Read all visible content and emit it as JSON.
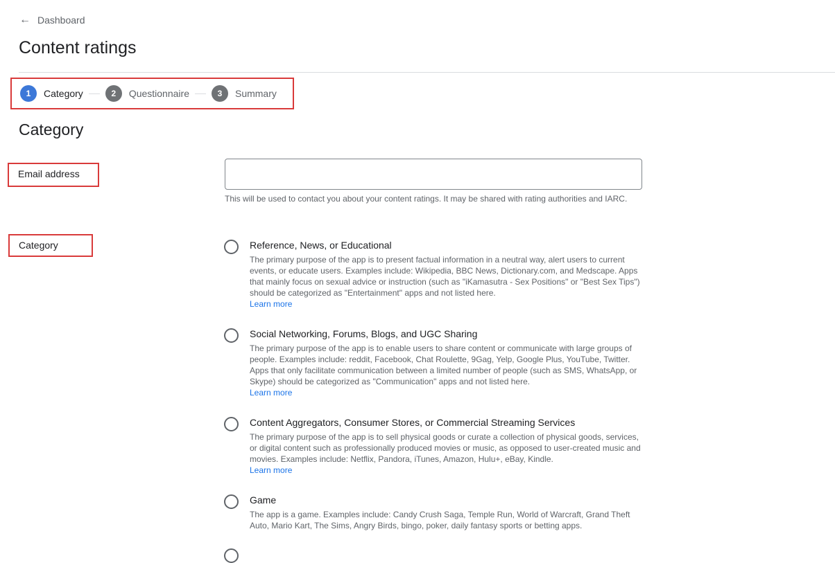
{
  "nav": {
    "back_label": "Dashboard",
    "back_icon": "arrow-left-icon"
  },
  "page": {
    "title": "Content ratings"
  },
  "stepper": {
    "steps": [
      {
        "number": "1",
        "label": "Category",
        "state": "active"
      },
      {
        "number": "2",
        "label": "Questionnaire",
        "state": "inactive"
      },
      {
        "number": "3",
        "label": "Summary",
        "state": "inactive"
      }
    ]
  },
  "section": {
    "title": "Category"
  },
  "email": {
    "label": "Email address",
    "value": "",
    "placeholder": "",
    "helper": "This will be used to contact you about your content ratings. It may be shared with rating authorities and IARC."
  },
  "category": {
    "label": "Category",
    "learn_more": "Learn more",
    "options": [
      {
        "title": "Reference, News, or Educational",
        "description": "The primary purpose of the app is to present factual information in a neutral way, alert users to current events, or educate users. Examples include: Wikipedia, BBC News, Dictionary.com, and Medscape. Apps that mainly focus on sexual advice or instruction (such as \"iKamasutra - Sex Positions\" or \"Best Sex Tips\") should be categorized as \"Entertainment\" apps and not listed here.",
        "has_learn_more": true,
        "selected": false
      },
      {
        "title": "Social Networking, Forums, Blogs, and UGC Sharing",
        "description": "The primary purpose of the app is to enable users to share content or communicate with large groups of people. Examples include: reddit, Facebook, Chat Roulette, 9Gag, Yelp, Google Plus, YouTube, Twitter. Apps that only facilitate communication between a limited number of people (such as SMS, WhatsApp, or Skype) should be categorized as \"Communication\" apps and not listed here.",
        "has_learn_more": true,
        "selected": false
      },
      {
        "title": "Content Aggregators, Consumer Stores, or Commercial Streaming Services",
        "description": "The primary purpose of the app is to sell physical goods or curate a collection of physical goods, services, or digital content such as professionally produced movies or music, as opposed to user-created music and movies. Examples include: Netflix, Pandora, iTunes, Amazon, Hulu+, eBay, Kindle.",
        "has_learn_more": true,
        "selected": false
      },
      {
        "title": "Game",
        "description": "The app is a game. Examples include: Candy Crush Saga, Temple Run, World of Warcraft, Grand Theft Auto, Mario Kart, The Sims, Angry Birds, bingo, poker, daily fantasy sports or betting apps.",
        "has_learn_more": false,
        "selected": false
      }
    ]
  }
}
